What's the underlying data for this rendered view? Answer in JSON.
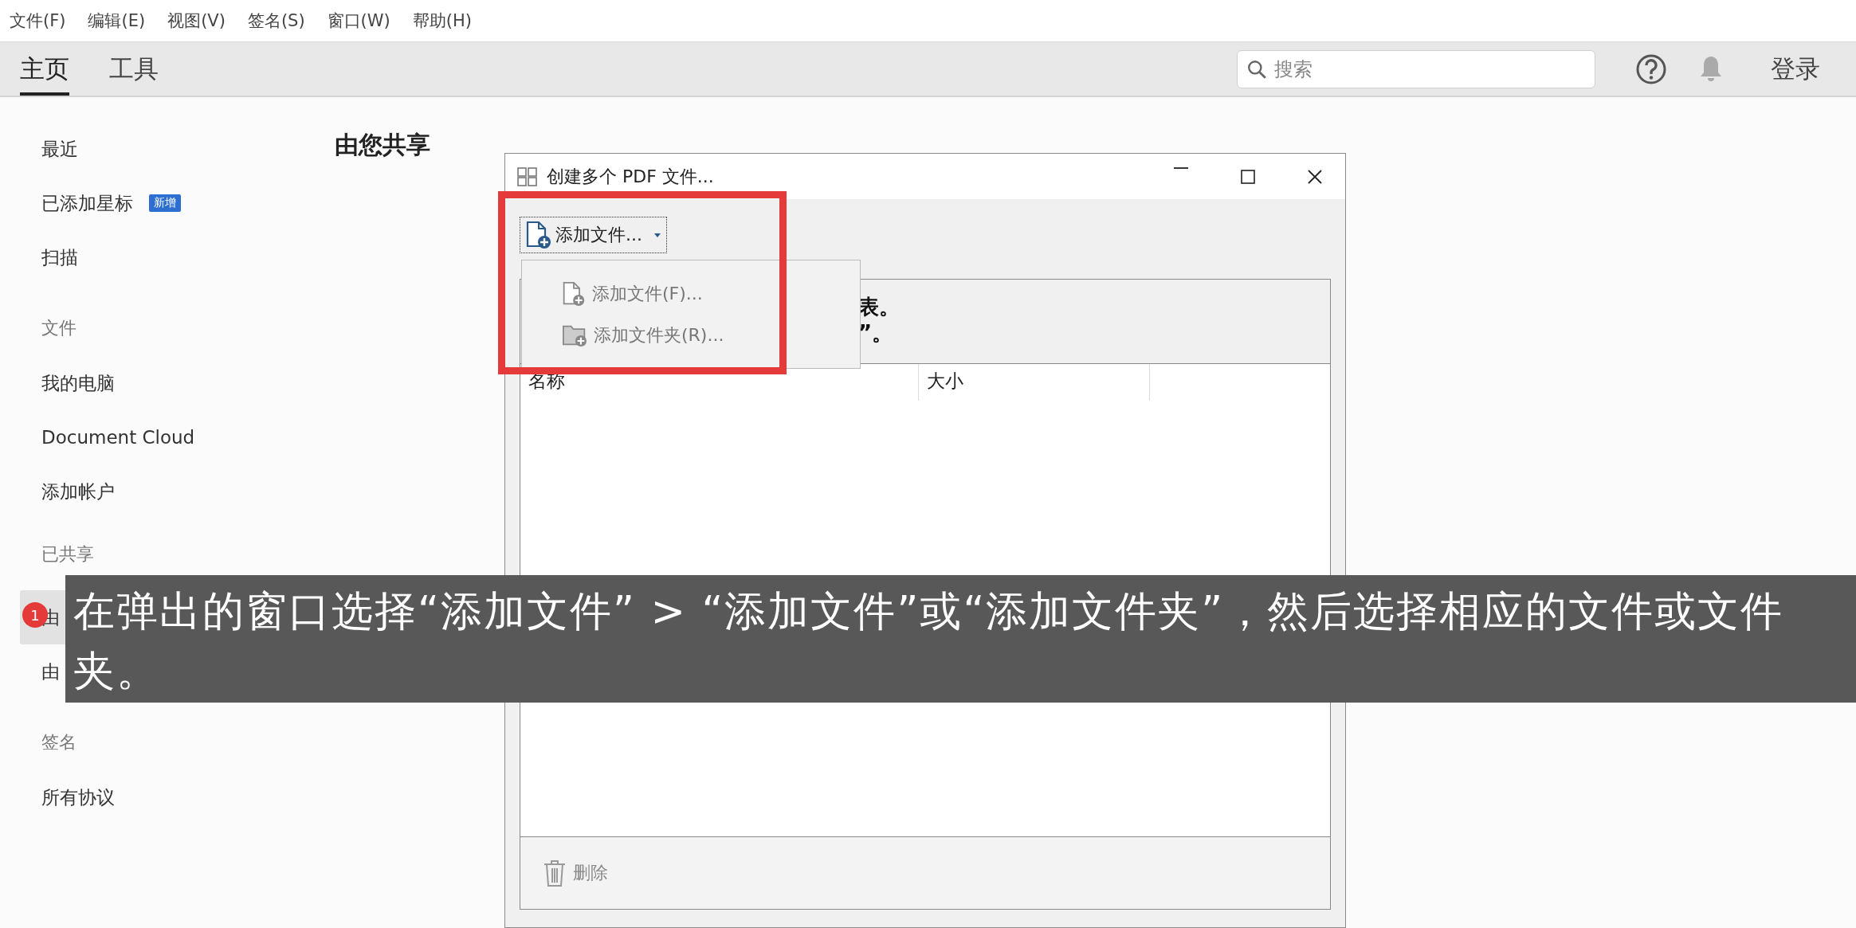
{
  "menu_bar": [
    "文件(F)",
    "编辑(E)",
    "视图(V)",
    "签名(S)",
    "窗口(W)",
    "帮助(H)"
  ],
  "tabs": [
    {
      "label": "主页",
      "selected": true
    },
    {
      "label": "工具",
      "selected": false
    }
  ],
  "search": {
    "placeholder": "搜索"
  },
  "login": "登录",
  "sidebar": [
    {
      "items": [
        {
          "label": "最近",
          "selected": false
        },
        {
          "label": "已添加星标",
          "badge": "新增",
          "selected": false
        },
        {
          "label": "扫描",
          "selected": false
        }
      ]
    },
    {
      "header": "文件",
      "items": [
        {
          "label": "我的电脑",
          "selected": false
        },
        {
          "label": "Document Cloud",
          "selected": false
        },
        {
          "label": "添加帐户",
          "selected": false
        }
      ]
    },
    {
      "header": "已共享",
      "items": [
        {
          "label": "由",
          "selected": true
        },
        {
          "label": "由",
          "selected": false
        }
      ]
    },
    {
      "header": "签名",
      "items": [
        {
          "label": "所有协议",
          "selected": false
        }
      ]
    }
  ],
  "page_heading": "由您共享",
  "dialog": {
    "title": "创建多个 PDF 文件...",
    "add_button": "添加文件...",
    "menu": [
      {
        "label": "添加文件(F)...",
        "kind": "file"
      },
      {
        "label": "添加文件夹(R)...",
        "kind": "folder"
      }
    ],
    "instructions": [
      "表。",
      "”。"
    ],
    "columns": [
      "名称",
      "大小"
    ],
    "delete_button": "删除"
  },
  "caption": {
    "step": "1",
    "text": "在弹出的窗口选择“添加文件” > “添加文件”或“添加文件夹”，然后选择相应的文件或文件夹。"
  }
}
